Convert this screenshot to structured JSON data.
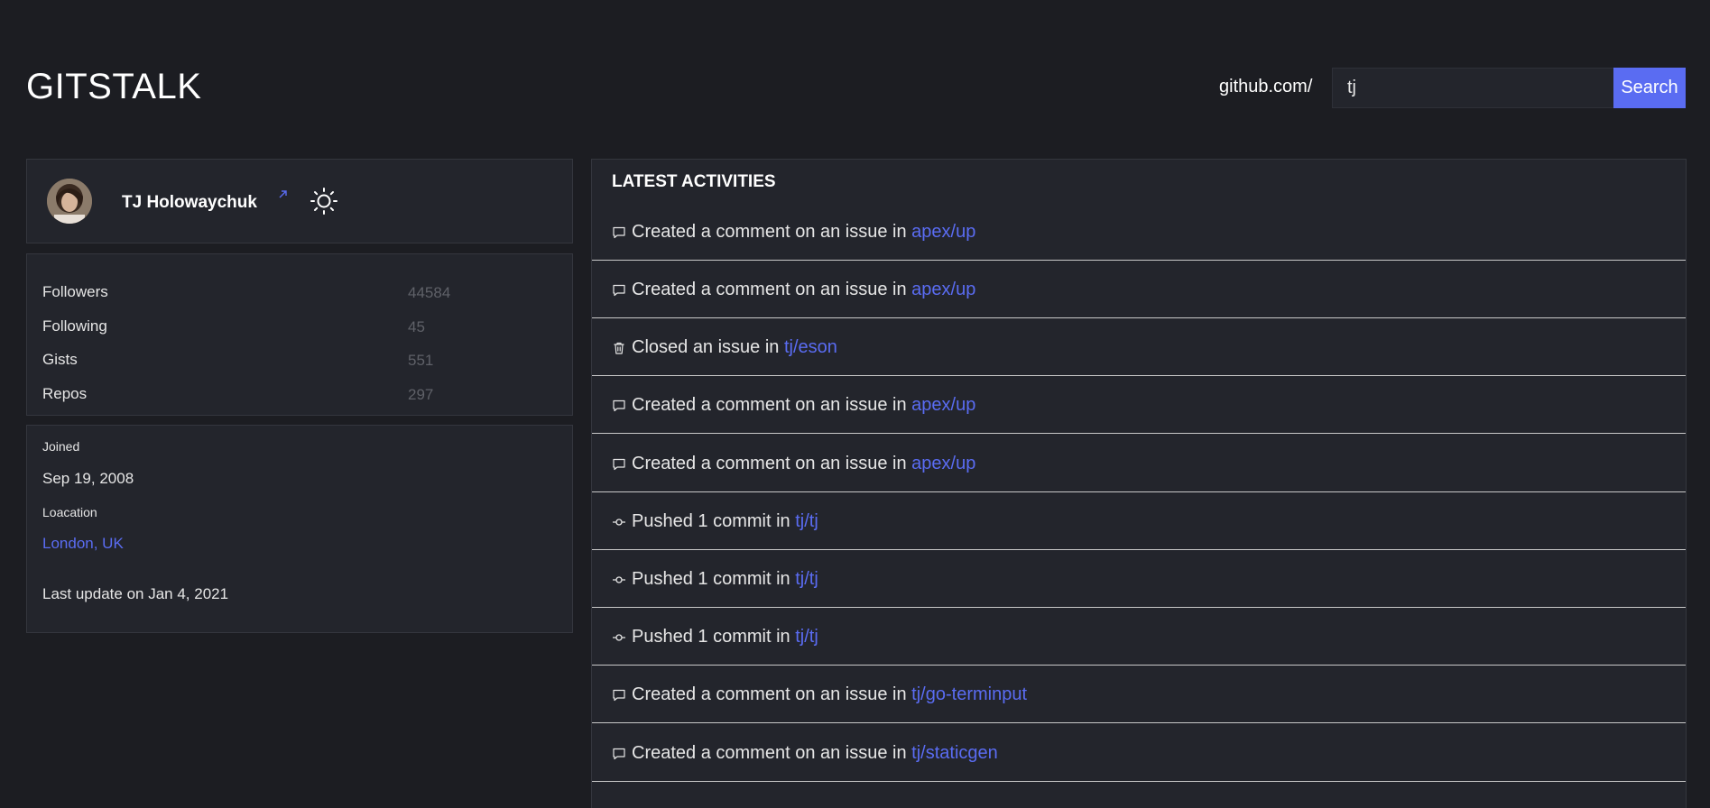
{
  "header": {
    "logo": "GITSTALK",
    "search_prefix": "github.com/",
    "search_value": "tj",
    "search_button": "Search"
  },
  "profile": {
    "name": "TJ Holowaychuk"
  },
  "stats": [
    {
      "label": "Followers",
      "value": "44584"
    },
    {
      "label": "Following",
      "value": "45"
    },
    {
      "label": "Gists",
      "value": "551"
    },
    {
      "label": "Repos",
      "value": "297"
    }
  ],
  "info": {
    "joined_label": "Joined",
    "joined_value": "Sep 19, 2008",
    "location_label": "Loacation",
    "location_value": "London, UK",
    "last_update": "Last update on Jan 4, 2021"
  },
  "activities": {
    "title": "LATEST ACTIVITIES",
    "items": [
      {
        "icon": "comment-icon",
        "text": "Created a comment on an issue in ",
        "repo": "apex/up"
      },
      {
        "icon": "comment-icon",
        "text": "Created a comment on an issue in ",
        "repo": "apex/up"
      },
      {
        "icon": "trash-icon",
        "text": "Closed an issue in ",
        "repo": "tj/eson"
      },
      {
        "icon": "comment-icon",
        "text": "Created a comment on an issue in ",
        "repo": "apex/up"
      },
      {
        "icon": "comment-icon",
        "text": "Created a comment on an issue in ",
        "repo": "apex/up"
      },
      {
        "icon": "commit-icon",
        "text": "Pushed 1 commit in ",
        "repo": "tj/tj"
      },
      {
        "icon": "commit-icon",
        "text": "Pushed 1 commit in ",
        "repo": "tj/tj"
      },
      {
        "icon": "commit-icon",
        "text": "Pushed 1 commit in ",
        "repo": "tj/tj"
      },
      {
        "icon": "comment-icon",
        "text": "Created a comment on an issue in ",
        "repo": "tj/go-terminput"
      },
      {
        "icon": "comment-icon",
        "text": "Created a comment on an issue in ",
        "repo": "tj/staticgen"
      }
    ]
  },
  "colors": {
    "background": "#1c1d22",
    "card": "#23252c",
    "accent": "#5a6cf2"
  }
}
